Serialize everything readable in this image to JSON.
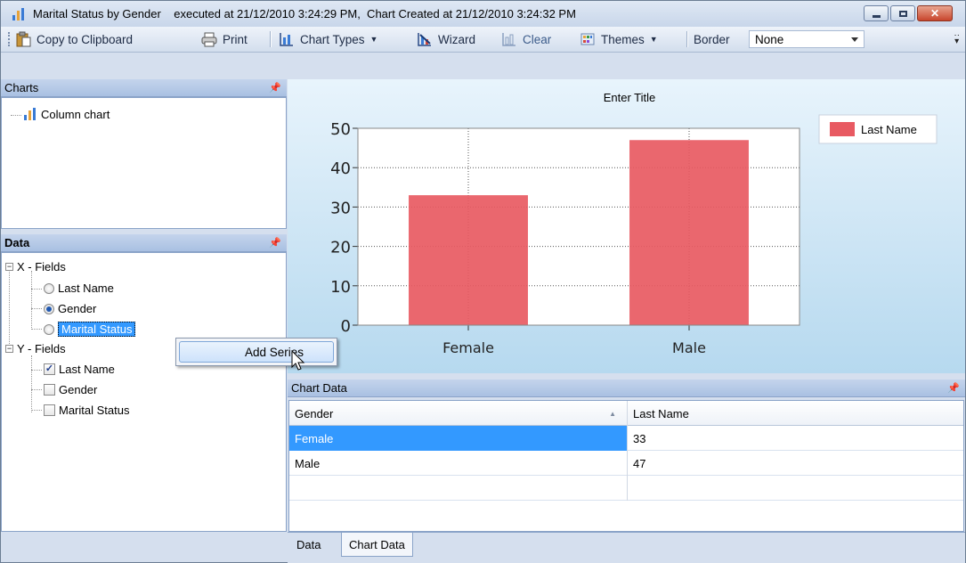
{
  "window": {
    "title": "Marital Status by Gender    executed at 21/12/2010 3:24:29 PM,  Chart Created at 21/12/2010 3:24:32 PM",
    "icon": "bar-chart-icon"
  },
  "toolbar": {
    "copy_label": "Copy to Clipboard",
    "print_label": "Print",
    "chart_types_label": "Chart Types",
    "wizard_label": "Wizard",
    "clear_label": "Clear",
    "themes_label": "Themes",
    "border_label": "Border",
    "border_value": "None"
  },
  "charts_panel": {
    "title": "Charts",
    "items": [
      {
        "label": "Column chart",
        "icon": "bar-chart-icon"
      }
    ]
  },
  "data_panel": {
    "title": "Data",
    "x_fields": {
      "label": "X - Fields",
      "items": [
        {
          "label": "Last Name",
          "selected": false
        },
        {
          "label": "Gender",
          "selected": true
        },
        {
          "label": "Marital Status",
          "selected": false
        }
      ]
    },
    "y_fields": {
      "label": "Y - Fields",
      "items": [
        {
          "label": "Last Name",
          "checked": true
        },
        {
          "label": "Gender",
          "checked": false
        },
        {
          "label": "Marital Status",
          "checked": false
        }
      ]
    }
  },
  "context_menu": {
    "add_series": "Add Series"
  },
  "chart_data": {
    "type": "bar",
    "title": "Enter Title",
    "categories": [
      "Female",
      "Male"
    ],
    "series": [
      {
        "name": "Last Name",
        "values": [
          33,
          47
        ],
        "color": "#e85a62"
      }
    ],
    "ylim": [
      0,
      50
    ],
    "yticks": [
      "0",
      "10",
      "20",
      "30",
      "40",
      "50"
    ],
    "grid": true,
    "legend": "top-right"
  },
  "chart_data_panel": {
    "title": "Chart Data",
    "columns": [
      "Gender",
      "Last Name"
    ],
    "rows": [
      {
        "gender": "Female",
        "last_name": "33"
      },
      {
        "gender": "Male",
        "last_name": "47"
      }
    ]
  },
  "bottom_tabs": [
    "Data",
    "Chart Data"
  ],
  "colors": {
    "accent": "#3399ff",
    "bar": "#e85a62"
  }
}
